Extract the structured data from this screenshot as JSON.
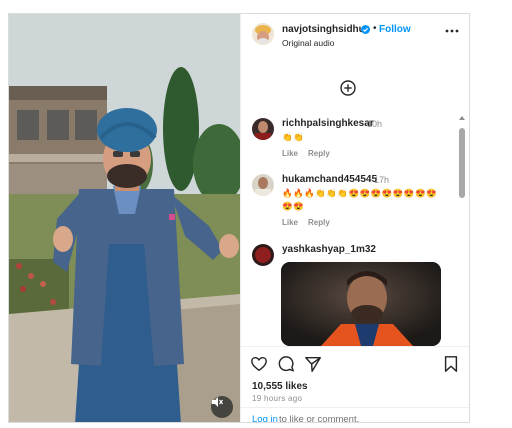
{
  "post": {
    "username": "navjotsinghsidhu",
    "dot": "•",
    "follow_label": "Follow",
    "audio": "Original audio",
    "add_comment_icon": "plus-circle-icon",
    "more_icon": "more-horizontal-icon",
    "media_mute_icon": "speaker-muted-icon"
  },
  "comments": [
    {
      "user": "richhpalsinghkesar",
      "time": "10h",
      "text": "👏👏",
      "like": "Like",
      "reply": "Reply"
    },
    {
      "user": "hukamchand454545",
      "time": "17h",
      "text": "🔥🔥🔥👏👏👏😍😍😍😍😍😍😍😍😍😍",
      "like": "Like",
      "reply": "Reply"
    },
    {
      "user": "yashkashyap_1m32"
    }
  ],
  "actions": {
    "icons": [
      "heart-icon",
      "comment-icon",
      "share-icon",
      "bookmark-icon"
    ],
    "likes": "10,555 likes",
    "ago": "19 hours ago",
    "login_link": "Log in",
    "login_rest": "to like or comment."
  },
  "colors": {
    "accent": "#0095f6",
    "turban": "#2f6f9e",
    "jacket": "#3f5f86"
  }
}
